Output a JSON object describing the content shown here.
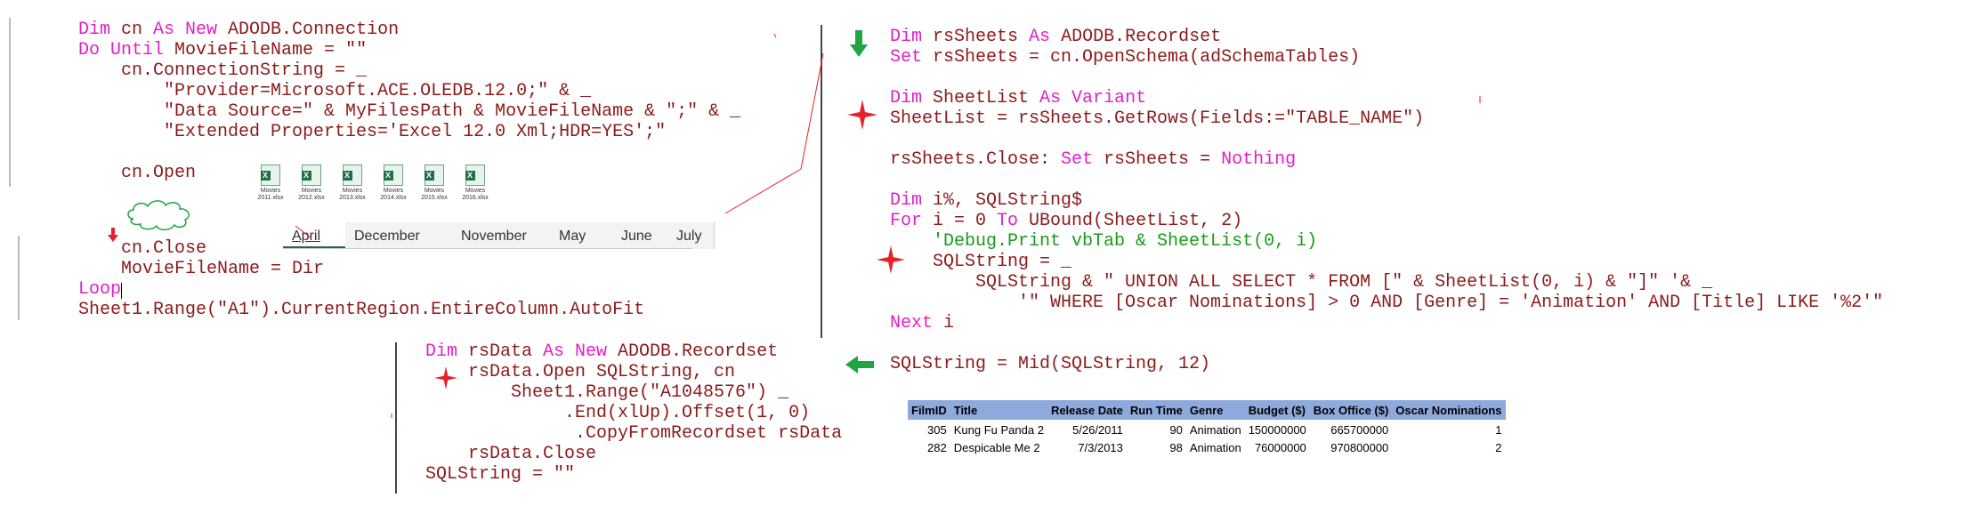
{
  "block1": {
    "lines": [
      [
        [
          "kw",
          "Dim "
        ],
        [
          "tx",
          "cn "
        ],
        [
          "kw",
          "As New "
        ],
        [
          "tx",
          "ADODB.Connection"
        ]
      ],
      [
        [
          "kw",
          "Do Until "
        ],
        [
          "tx",
          "MovieFileName = \"\""
        ]
      ],
      [
        [
          "tx",
          "    cn.ConnectionString = _"
        ]
      ],
      [
        [
          "tx",
          "        \"Provider=Microsoft.ACE.OLEDB.12.0;\" & _"
        ]
      ],
      [
        [
          "tx",
          "        \"Data Source=\" & MyFilesPath & MovieFileName & \";\" & _"
        ]
      ],
      [
        [
          "tx",
          "        \"Extended Properties='Excel 12.0 Xml;HDR=YES';\""
        ]
      ],
      [
        [
          "tx",
          ""
        ]
      ],
      [
        [
          "tx",
          "    cn.Open"
        ]
      ]
    ]
  },
  "block2": {
    "lines": [
      [
        [
          "tx",
          "    cn.Close"
        ]
      ],
      [
        [
          "tx",
          "    MovieFileName = Dir"
        ]
      ],
      [
        [
          "kw",
          "Loop"
        ]
      ],
      [
        [
          "tx",
          "Sheet1.Range(\"A1\").CurrentRegion.EntireColumn.AutoFit"
        ]
      ]
    ]
  },
  "block3": {
    "lines": [
      [
        [
          "kw",
          "Dim "
        ],
        [
          "tx",
          "rsSheets "
        ],
        [
          "kw",
          "As "
        ],
        [
          "tx",
          "ADODB.Recordset"
        ]
      ],
      [
        [
          "kw",
          "Set "
        ],
        [
          "tx",
          "rsSheets = cn.OpenSchema(adSchemaTables)"
        ]
      ],
      [
        [
          "tx",
          ""
        ]
      ],
      [
        [
          "kw",
          "Dim "
        ],
        [
          "tx",
          "SheetList "
        ],
        [
          "kw",
          "As Variant"
        ]
      ],
      [
        [
          "tx",
          "SheetList = rsSheets.GetRows(Fields:=\"TABLE_NAME\")"
        ]
      ],
      [
        [
          "tx",
          ""
        ]
      ],
      [
        [
          "tx",
          "rsSheets.Close: "
        ],
        [
          "kw",
          "Set "
        ],
        [
          "tx",
          "rsSheets = "
        ],
        [
          "kw",
          "Nothing"
        ]
      ],
      [
        [
          "tx",
          ""
        ]
      ],
      [
        [
          "kw",
          "Dim "
        ],
        [
          "tx",
          "i%, SQLString$"
        ]
      ],
      [
        [
          "kw",
          "For "
        ],
        [
          "tx",
          "i = 0 "
        ],
        [
          "kw",
          "To "
        ],
        [
          "tx",
          "UBound(SheetList, 2)"
        ]
      ],
      [
        [
          "cm",
          "    'Debug.Print vbTab & SheetList(0, i)"
        ]
      ],
      [
        [
          "tx",
          "    SQLString = _"
        ]
      ],
      [
        [
          "tx",
          "        SQLString & \" UNION ALL SELECT * FROM [\" & SheetList(0, i) & \"]\" '& _"
        ]
      ],
      [
        [
          "tx",
          "            '\" WHERE [Oscar Nominations] > 0 AND [Genre] = 'Animation' AND [Title] LIKE '%2'\""
        ]
      ],
      [
        [
          "kw",
          "Next "
        ],
        [
          "tx",
          "i"
        ]
      ],
      [
        [
          "tx",
          ""
        ]
      ],
      [
        [
          "tx",
          "SQLString = Mid(SQLString, 12)"
        ]
      ]
    ]
  },
  "block4": {
    "lines": [
      [
        [
          "kw",
          "Dim "
        ],
        [
          "tx",
          "rsData "
        ],
        [
          "kw",
          "As New "
        ],
        [
          "tx",
          "ADODB.Recordset"
        ]
      ],
      [
        [
          "tx",
          "    rsData.Open SQLString, cn"
        ]
      ],
      [
        [
          "tx",
          "        Sheet1.Range(\"A1048576\") _"
        ]
      ],
      [
        [
          "tx",
          "             .End(xlUp).Offset(1, 0)"
        ]
      ],
      [
        [
          "tx",
          "              .CopyFromRecordset rsData"
        ]
      ],
      [
        [
          "tx",
          "    rsData.Close"
        ]
      ],
      [
        [
          "tx",
          "SQLString = \"\""
        ]
      ]
    ]
  },
  "files": [
    "Movies 2011.xlsx",
    "Movies 2012.xlsx",
    "Movies 2013.xlsx",
    "Movies 2014.xlsx",
    "Movies 2015.xlsx",
    "Movies 2016.xlsx"
  ],
  "tabs": [
    "April",
    "December",
    "November",
    "May",
    "June",
    "July"
  ],
  "results": {
    "headers": [
      "FilmID",
      "Title",
      "Release Date",
      "Run Time",
      "Genre",
      "Budget ($)",
      "Box Office ($)",
      "Oscar Nominations"
    ],
    "rows": [
      [
        "305",
        "Kung Fu Panda 2",
        "5/26/2011",
        "90",
        "Animation",
        "150000000",
        "665700000",
        "1"
      ],
      [
        "282",
        "Despicable Me 2",
        "7/3/2013",
        "98",
        "Animation",
        "76000000",
        "970800000",
        "2"
      ]
    ]
  },
  "colors": {
    "keyword": "#e020c8",
    "text": "#8b1a1a",
    "comment": "#1a9a1a",
    "accent_green": "#1fa544",
    "star_red": "#e8202a",
    "table_header": "#8ea9db"
  }
}
